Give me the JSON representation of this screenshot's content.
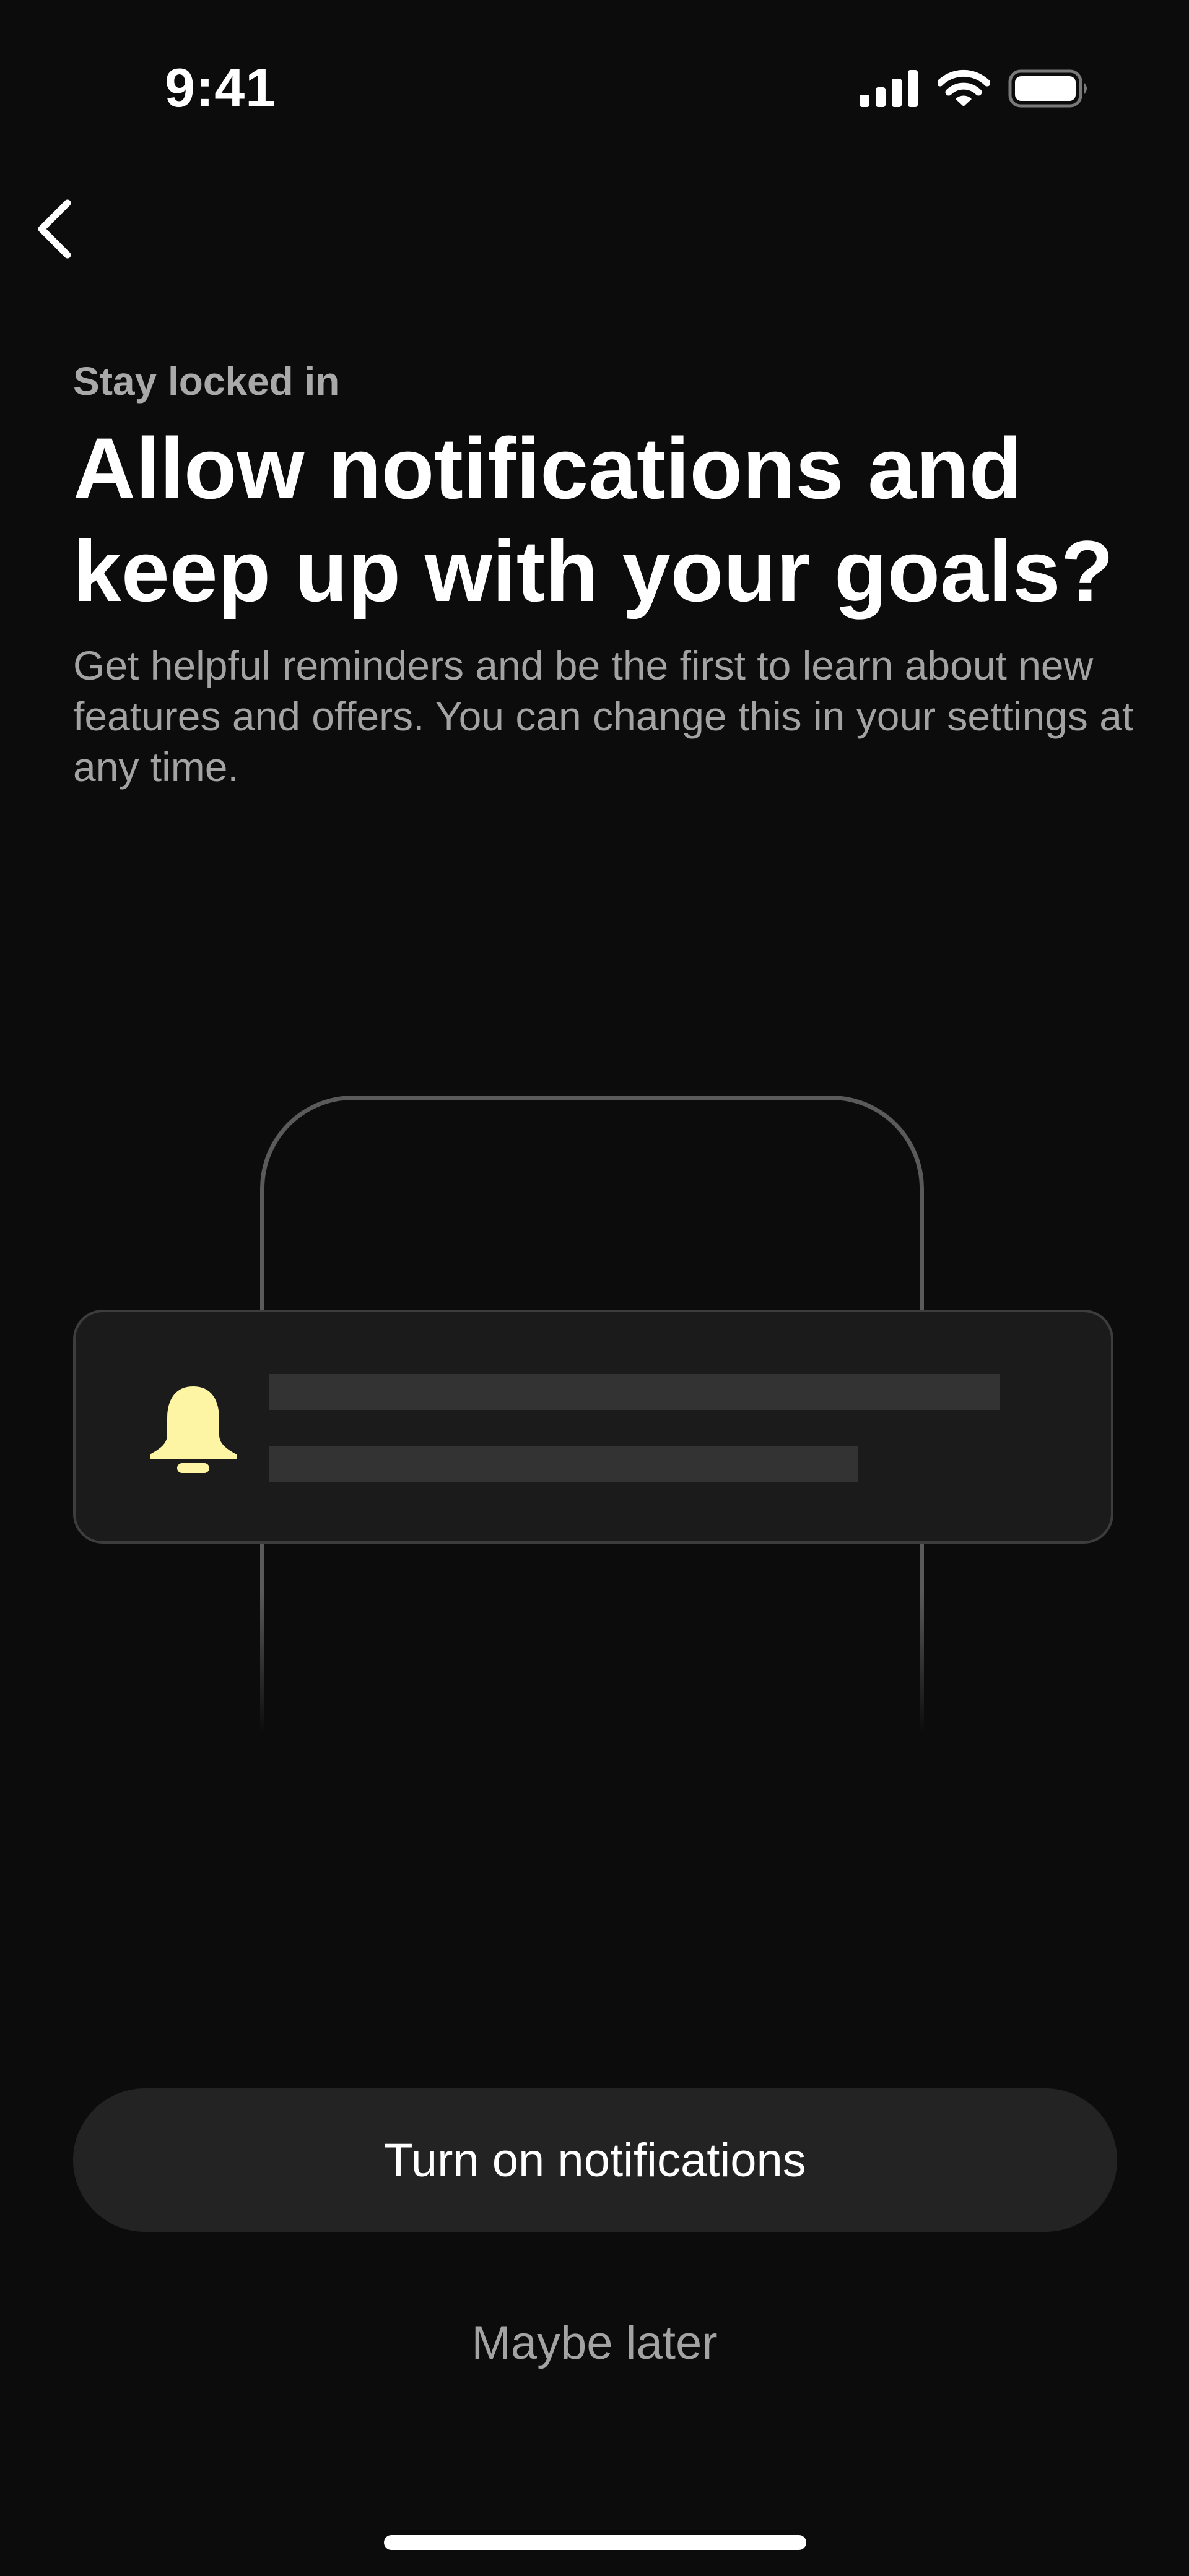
{
  "status_bar": {
    "time": "9:41",
    "icons": [
      "cellular-signal-icon",
      "wifi-icon",
      "battery-icon"
    ]
  },
  "nav": {
    "back_icon": "chevron-left-icon"
  },
  "content": {
    "eyebrow": "Stay locked in",
    "title": "Allow notifications and keep up with your goals?",
    "description": "Get helpful reminders and be the first to learn about new features and offers. You can change this in your settings at any time."
  },
  "illustration": {
    "icon": "bell-icon",
    "accent_color": "#FDF5A3"
  },
  "actions": {
    "primary_label": "Turn on notifications",
    "secondary_label": "Maybe later"
  },
  "colors": {
    "background": "#0C0C0C",
    "primary_button": "#232323",
    "text_secondary": "#A3A3A3"
  }
}
